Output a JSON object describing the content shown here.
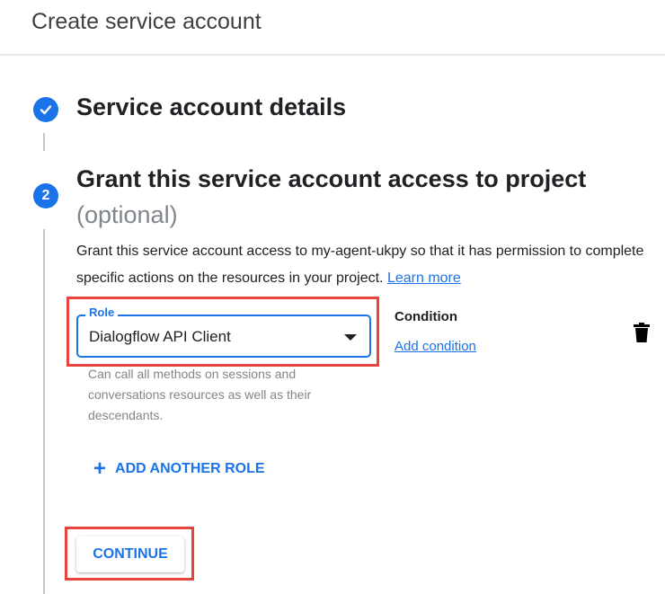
{
  "header": {
    "title": "Create service account"
  },
  "steps": [
    {
      "number": "✓",
      "title": "Service account details",
      "status": "complete"
    },
    {
      "number": "2",
      "title": "Grant this service account access to project",
      "subtitle": "(optional)",
      "status": "active"
    }
  ],
  "grant": {
    "description": "Grant this service account access to my-agent-ukpy so that it has permission to complete specific actions on the resources in your project.",
    "learn_more": "Learn more"
  },
  "role": {
    "label": "Role",
    "value": "Dialogflow API Client",
    "help": "Can call all methods on sessions and conversations resources as well as their descendants."
  },
  "condition": {
    "label": "Condition",
    "link": "Add condition"
  },
  "actions": {
    "add_role": "ADD ANOTHER ROLE",
    "continue": "CONTINUE"
  },
  "icons": {
    "step1": "check-icon",
    "delete": "trash-icon",
    "add": "plus-icon",
    "dropdown": "caret-down-icon"
  },
  "colors": {
    "accent": "#1a73e8",
    "highlight": "#e5453c"
  }
}
